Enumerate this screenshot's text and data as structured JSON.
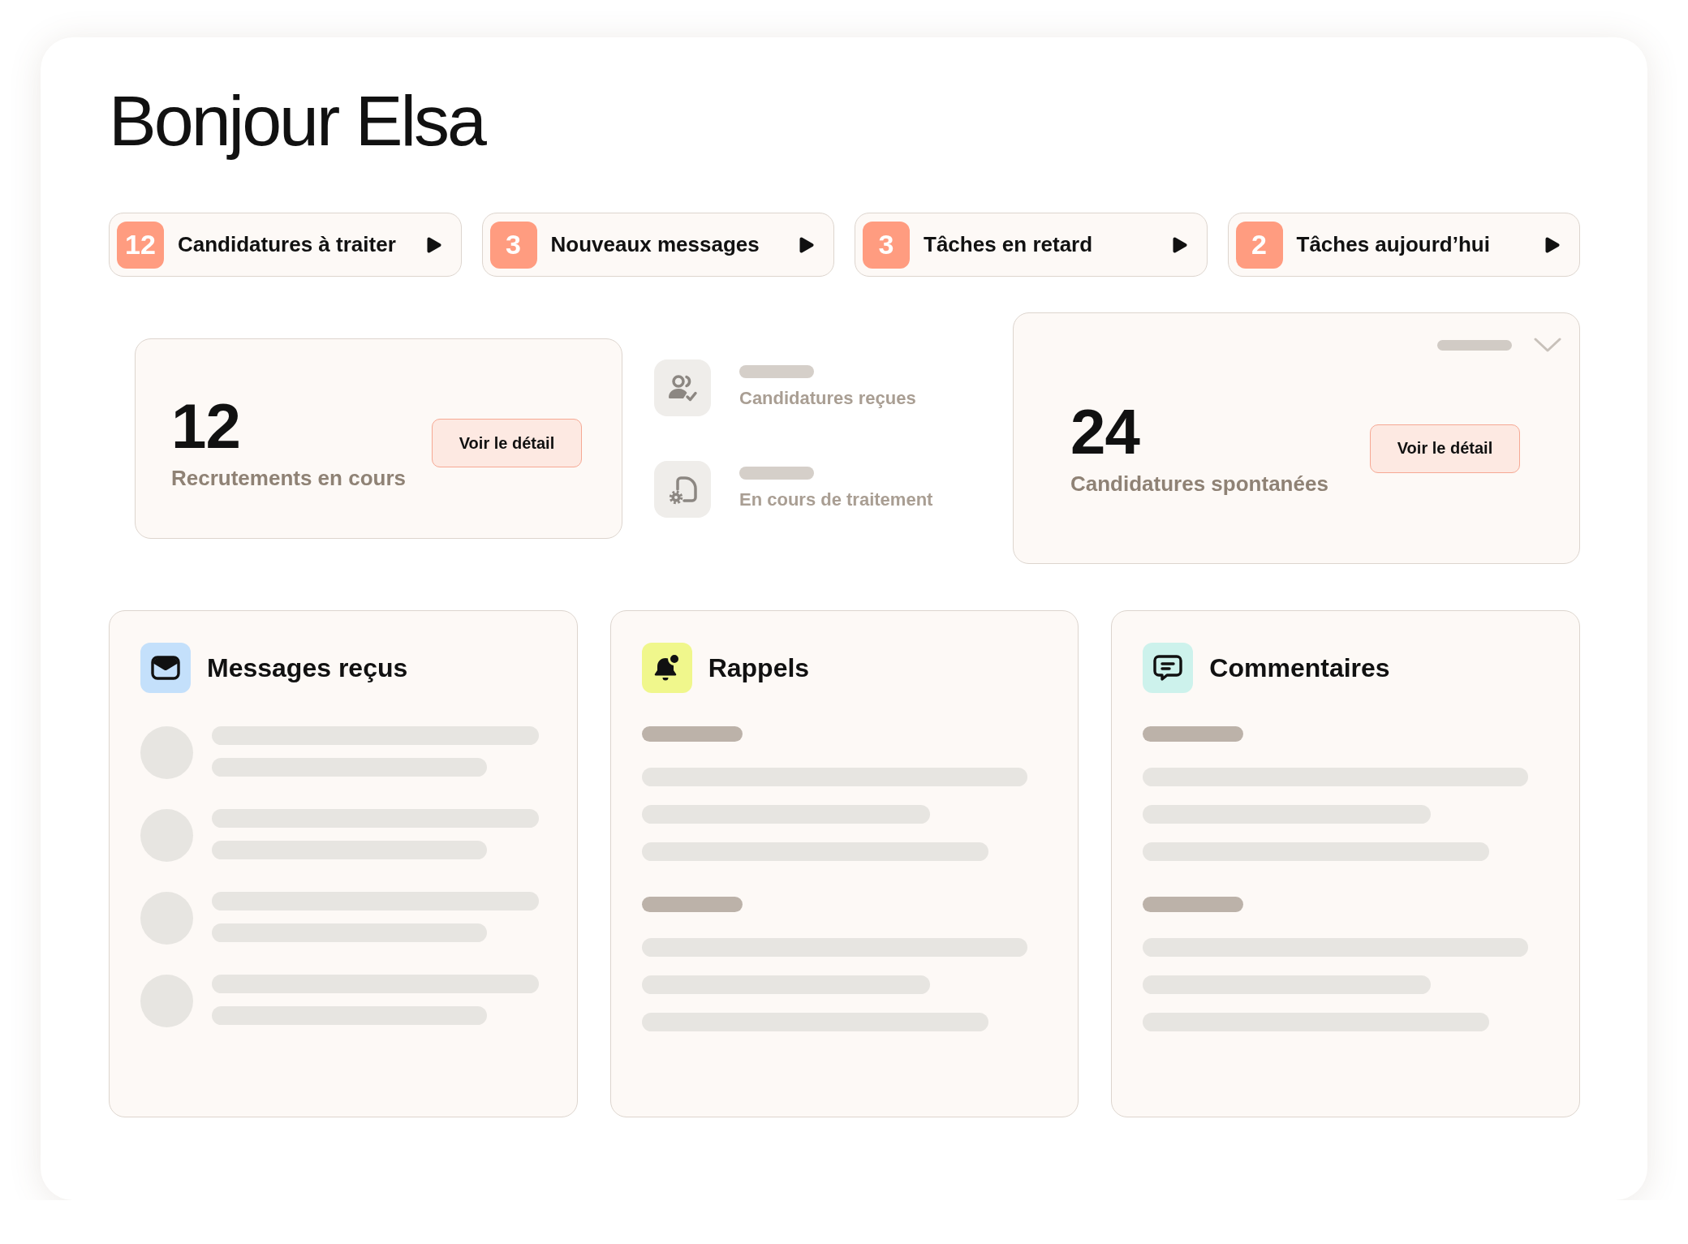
{
  "greeting": "Bonjour Elsa",
  "shortcuts": [
    {
      "count": "12",
      "label": "Candidatures à traiter"
    },
    {
      "count": "3",
      "label": "Nouveaux messages"
    },
    {
      "count": "3",
      "label": "Tâches en retard"
    },
    {
      "count": "2",
      "label": "Tâches aujourd’hui"
    }
  ],
  "recruitments": {
    "value": "12",
    "label": "Recrutements en cours",
    "button": "Voir le détail"
  },
  "pipeline": [
    {
      "kind": "received",
      "label": "Candidatures reçues"
    },
    {
      "kind": "processing",
      "label": "En cours de traitement"
    }
  ],
  "spontaneous": {
    "value": "24",
    "label": "Candidatures spontanées",
    "button": "Voir le détail"
  },
  "panels": [
    {
      "kind": "messages",
      "title": "Messages reçus"
    },
    {
      "kind": "reminders",
      "title": "Rappels"
    },
    {
      "kind": "comments",
      "title": "Commentaires"
    }
  ]
}
